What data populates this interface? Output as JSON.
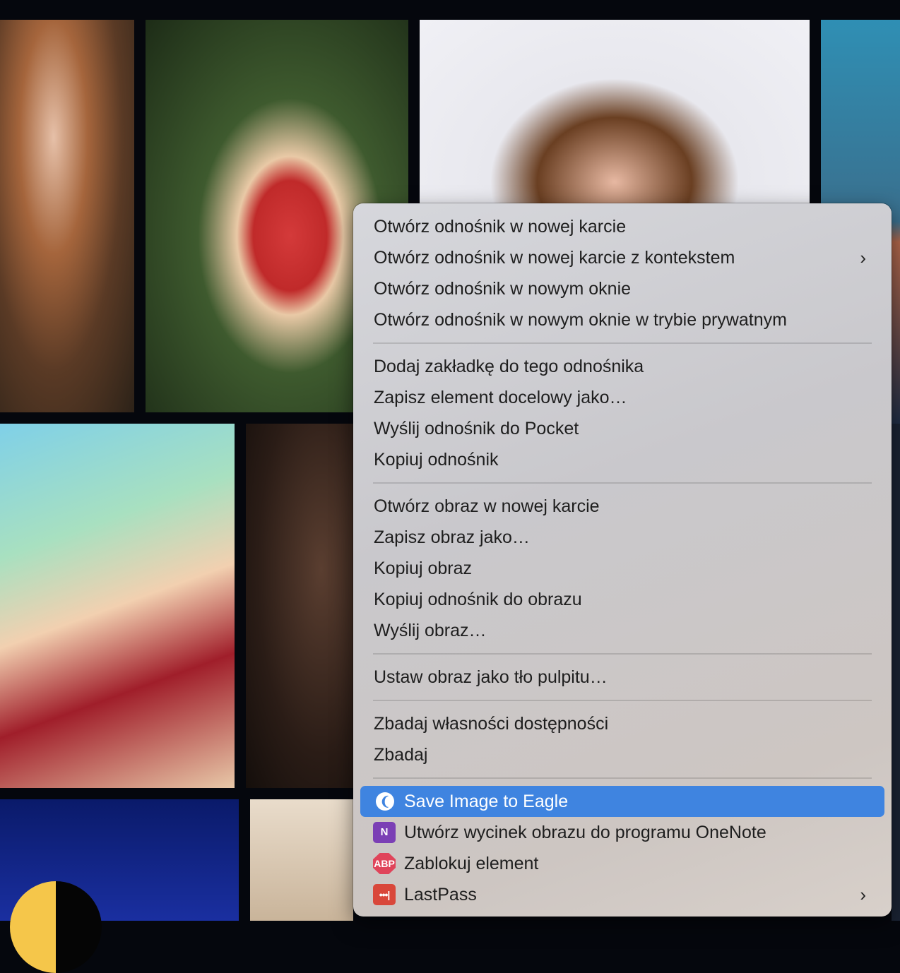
{
  "menu": {
    "groups": [
      [
        "Otwórz odnośnik w nowej karcie",
        "Otwórz odnośnik w nowej karcie z kontekstem",
        "Otwórz odnośnik w nowym oknie",
        "Otwórz odnośnik w nowym oknie w trybie prywatnym"
      ],
      [
        "Dodaj zakładkę do tego odnośnika",
        "Zapisz element docelowy jako…",
        "Wyślij odnośnik do Pocket",
        "Kopiuj odnośnik"
      ],
      [
        "Otwórz obraz w nowej karcie",
        "Zapisz obraz jako…",
        "Kopiuj obraz",
        "Kopiuj odnośnik do obrazu",
        "Wyślij obraz…"
      ],
      [
        "Ustaw obraz jako tło pulpitu…"
      ],
      [
        "Zbadaj własności dostępności",
        "Zbadaj"
      ]
    ],
    "extensions": [
      {
        "label": "Save Image to Eagle",
        "icon": "eagle-icon",
        "icon_text": "❨",
        "highlighted": true
      },
      {
        "label": "Utwórz wycinek obrazu do programu OneNote",
        "icon": "onenote-icon",
        "icon_text": "N"
      },
      {
        "label": "Zablokuj element",
        "icon": "adblock-plus-icon",
        "icon_text": "ABP"
      },
      {
        "label": "LastPass",
        "icon": "lastpass-icon",
        "icon_text": "•••|",
        "submenu": true
      }
    ],
    "submenu_arrow": "›",
    "highlight_color": "#3f84e0"
  }
}
